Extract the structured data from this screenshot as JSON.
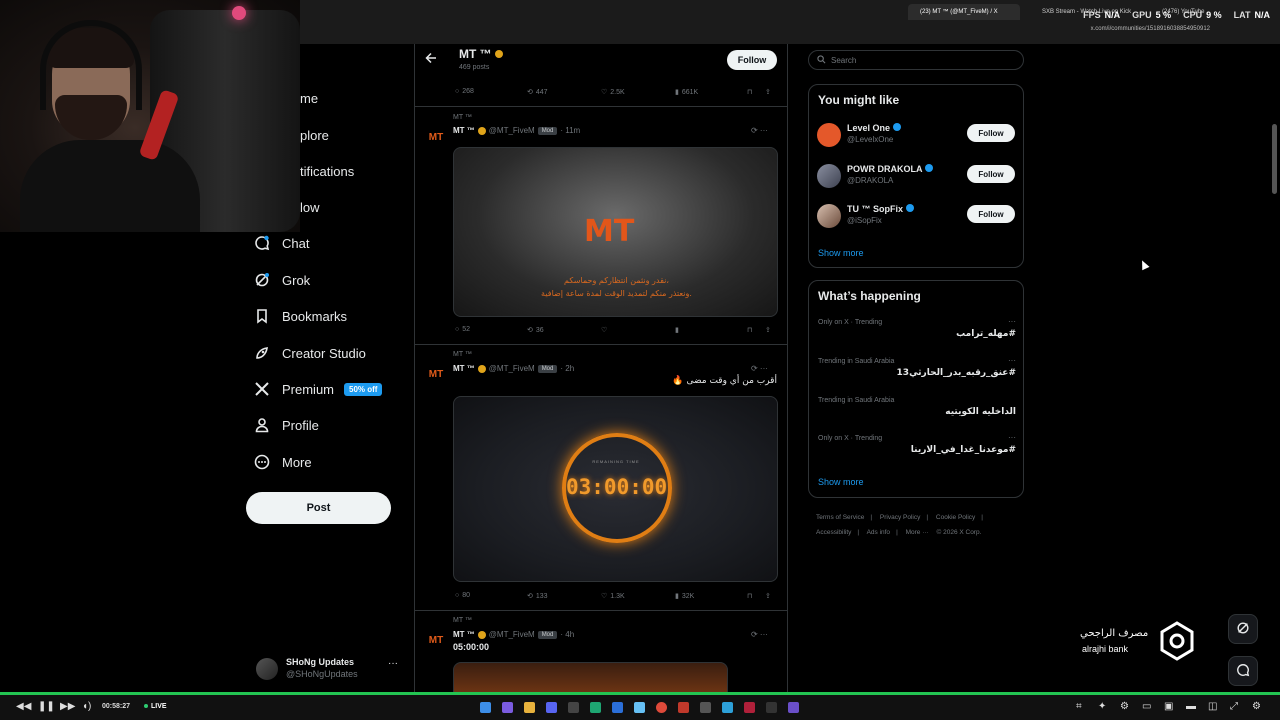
{
  "browser": {
    "tabs": [
      {
        "label": "(23) MT ™ (@MT_FiveM) / X",
        "active": true
      },
      {
        "label": "SXB Stream - Watch Live on Kick",
        "active": false
      },
      {
        "label": "(2476) YouTube",
        "active": false
      }
    ],
    "url": "x.com/i/communities/1518916038854950912"
  },
  "stats": [
    {
      "label": "FPS",
      "value": "N/A"
    },
    {
      "label": "GPU",
      "value": "5 %"
    },
    {
      "label": "CPU",
      "value": "9 %"
    },
    {
      "label": "LAT",
      "value": "N/A"
    }
  ],
  "nav": {
    "cut_items": [
      "me",
      "plore",
      "tifications",
      "low"
    ],
    "items": [
      {
        "label": "Chat",
        "icon": "chat-icon"
      },
      {
        "label": "Grok",
        "icon": "grok-icon"
      },
      {
        "label": "Bookmarks",
        "icon": "bookmark-icon"
      },
      {
        "label": "Creator Studio",
        "icon": "rocket-icon"
      },
      {
        "label": "Premium",
        "icon": "x-logo-icon"
      },
      {
        "label": "Profile",
        "icon": "profile-icon"
      },
      {
        "label": "More",
        "icon": "more-circle-icon"
      }
    ],
    "premium_badge": "50% off",
    "post_label": "Post"
  },
  "account": {
    "name": "SHoNg Updates",
    "handle": "@SHoNgUpdates",
    "more": "···"
  },
  "header": {
    "title": "MT ™",
    "post_count": "469 posts",
    "follow_label": "Follow"
  },
  "top_actions": {
    "replies": "268",
    "reposts": "447",
    "likes": "2.5K",
    "views": "661K"
  },
  "tweets": [
    {
      "community": "MT ™",
      "author": "MT ™",
      "handle": "@MT_FiveM",
      "badge": "Mod",
      "time": "11m",
      "text": "",
      "media_logo": "MT",
      "media_line1": "نقدر ونثمن انتظاركم وحماسكم،",
      "media_line2": "ونعتذر منكم لتمديد الوقت لمدة ساعة إضافية.",
      "replies": "52",
      "reposts": "36",
      "likes": "",
      "views": ""
    },
    {
      "community": "MT ™",
      "author": "MT ™",
      "handle": "@MT_FiveM",
      "badge": "Mod",
      "time": "2h",
      "text": "أقرب من أي وقت مضى 🔥",
      "timer_label": "REMAINING TIME",
      "timer": "03:00:00",
      "replies": "80",
      "reposts": "133",
      "likes": "1.3K",
      "views": "32K"
    },
    {
      "community": "MT ™",
      "author": "MT ™",
      "handle": "@MT_FiveM",
      "badge": "Mod",
      "time": "4h",
      "text": "05:00:00"
    }
  ],
  "search": {
    "placeholder": "Search"
  },
  "who_to_follow": {
    "title": "You might like",
    "items": [
      {
        "name": "Level One",
        "handle": "@LevelxOne",
        "follow": "Follow"
      },
      {
        "name": "POWR DRAKOLA",
        "handle": "@DRAKOLA",
        "follow": "Follow"
      },
      {
        "name": "TU ™ SopFix",
        "handle": "@iSopFix",
        "follow": "Follow"
      }
    ],
    "show_more": "Show more"
  },
  "trends": {
    "title": "What’s happening",
    "items": [
      {
        "meta": "Only on X · Trending",
        "name": "#مهله_ترامب"
      },
      {
        "meta": "Trending in Saudi Arabia",
        "name": "#عنق_رقبه_بدر_الحارثي13"
      },
      {
        "meta": "Trending in Saudi Arabia",
        "name": "الداخليه الكويتيه"
      },
      {
        "meta": "Only on X · Trending",
        "name": "#موعدنا_غدا_في_الارينا"
      }
    ],
    "show_more": "Show more"
  },
  "footer": [
    "Terms of Service",
    "|",
    "Privacy Policy",
    "|",
    "Cookie Policy",
    "|",
    "Accessibility",
    "|",
    "Ads info",
    "|",
    "More ···",
    "© 2026 X Corp."
  ],
  "bank": {
    "arabic": "مصرف الراجحي",
    "english": "alrajhi bank"
  },
  "player": {
    "time": "00:58:27",
    "live": "LIVE"
  },
  "colors": {
    "accent": "#1d9bf0",
    "brand_orange": "#e2561a",
    "progress": "#23c552"
  }
}
